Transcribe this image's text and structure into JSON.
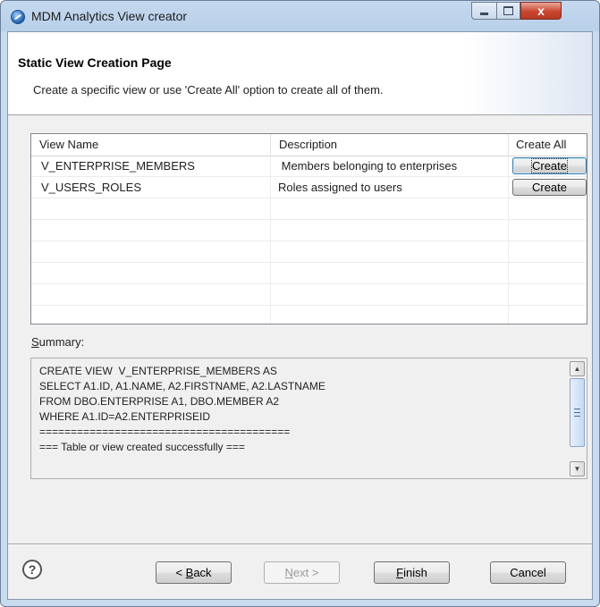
{
  "window": {
    "title": "MDM Analytics View creator",
    "accent": "#c4d8ee"
  },
  "page": {
    "title": "Static View Creation Page",
    "description": "Create a specific view or use 'Create All' option to create all of them."
  },
  "table": {
    "columns": [
      "View Name",
      "Description",
      "Create All"
    ],
    "rows": [
      {
        "name": "V_ENTERPRISE_MEMBERS",
        "description": " Members belonging to enterprises",
        "action": "Create"
      },
      {
        "name": "V_USERS_ROLES",
        "description": "Roles assigned to users",
        "action": "Create"
      }
    ]
  },
  "summary": {
    "label_accel": "S",
    "label_rest": "ummary:",
    "lines": [
      "CREATE VIEW  V_ENTERPRISE_MEMBERS AS",
      "SELECT A1.ID, A1.NAME, A2.FIRSTNAME, A2.LASTNAME",
      "FROM DBO.ENTERPRISE A1, DBO.MEMBER A2",
      "WHERE A1.ID=A2.ENTERPRISEID",
      "========================================",
      "=== Table or view created successfully ==="
    ]
  },
  "buttons": {
    "back_pre": "< ",
    "back_accel": "B",
    "back_rest": "ack",
    "next_accel": "N",
    "next_rest": "ext >",
    "finish_accel": "F",
    "finish_rest": "inish",
    "cancel": "Cancel"
  },
  "icons": {
    "app": "mdm-app-icon",
    "help": "help-icon",
    "help_glyph": "?",
    "close_glyph": "x"
  }
}
